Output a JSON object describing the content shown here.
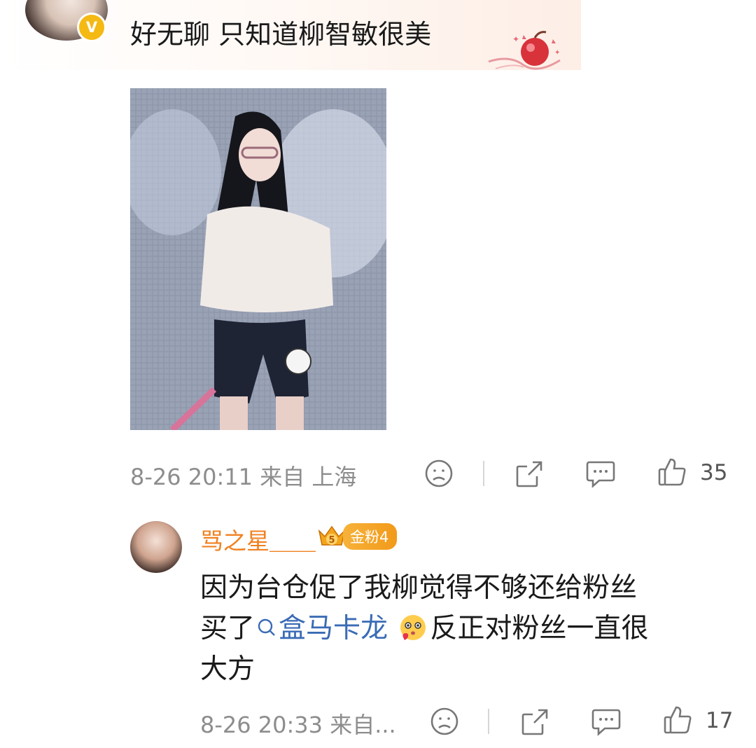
{
  "comment": {
    "verified_mark": "V",
    "text": "好无聊 只知道柳智敏很美",
    "meta": "8-26 20:11 来自 上海",
    "like_count": "35"
  },
  "reply": {
    "username": "骂之星＿＿",
    "fan_level": "5",
    "fan_label": "金粉4",
    "line1": "因为台仓促了我柳觉得不够还给粉丝",
    "line2_before": "买了",
    "topic": "盒马卡龙",
    "line2_after": "反正对粉丝一直很",
    "line3": "大方",
    "meta": "8-26 20:33 来自...",
    "like_count": "17"
  },
  "icons": {
    "face": "sad-face-icon",
    "share": "share-icon",
    "comment": "comment-icon",
    "like": "thumbs-up-icon",
    "search": "search-icon"
  },
  "colors": {
    "username": "#f08121",
    "link": "#3a6bb5",
    "meta": "#8d8d8d",
    "badge": "#f5b914"
  }
}
